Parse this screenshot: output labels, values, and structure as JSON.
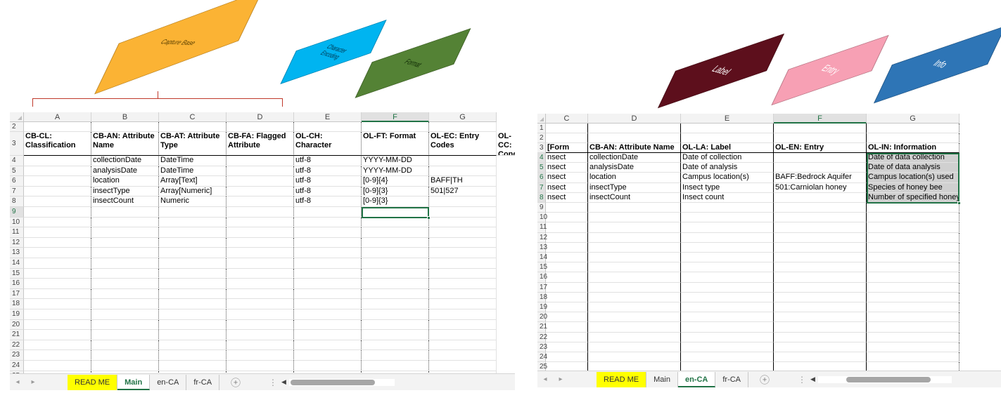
{
  "diagram": {
    "capture_base": {
      "label": "Capture Base",
      "color": "#fbb334"
    },
    "character_encoding": {
      "label": "Character Encoding",
      "color": "#00b4f0"
    },
    "format": {
      "label": "Format",
      "color": "#548235"
    },
    "label": {
      "label": "Label",
      "color": "#5d0f1c"
    },
    "entry": {
      "label": "Entry",
      "color": "#f7a0b4"
    },
    "info": {
      "label": "Info",
      "color": "#2e75b6"
    }
  },
  "left_sheet": {
    "columns": [
      "A",
      "B",
      "C",
      "D",
      "E",
      "F",
      "G"
    ],
    "selected_column": "F",
    "rows": [
      "2",
      "3",
      "4",
      "5",
      "6",
      "7",
      "8",
      "9",
      "10",
      "11",
      "12",
      "13",
      "14",
      "15",
      "16",
      "17",
      "18",
      "19",
      "20",
      "21",
      "22",
      "23",
      "24",
      "25"
    ],
    "headers": [
      "CB-CL: Classification",
      "CB-AN: Attribute Name",
      "CB-AT: Attribute Type",
      "CB-FA: Flagged Attribute",
      "OL-CH: Character",
      "OL-FT: Format",
      "OL-EC: Entry Codes",
      "OL-CC: Cond"
    ],
    "data": [
      [
        "",
        "collectionDate",
        "DateTime",
        "",
        "utf-8",
        "YYYY-MM-DD",
        ""
      ],
      [
        "",
        "analysisDate",
        "DateTime",
        "",
        "utf-8",
        "YYYY-MM-DD",
        ""
      ],
      [
        "",
        "location",
        "Array[Text]",
        "",
        "utf-8",
        "[0-9]{4}",
        "BAFF|TH"
      ],
      [
        "",
        "insectType",
        "Array[Numeric]",
        "",
        "utf-8",
        "[0-9]{3}",
        "501|527"
      ],
      [
        "",
        "insectCount",
        "Numeric",
        "",
        "utf-8",
        "[0-9]{3}",
        ""
      ]
    ],
    "tabs": [
      "READ ME",
      "Main",
      "en-CA",
      "fr-CA"
    ],
    "active_tab": "Main"
  },
  "right_sheet": {
    "columns": [
      "C",
      "D",
      "E",
      "F",
      "G"
    ],
    "selected_column": "F",
    "rows": [
      "1",
      "2",
      "3",
      "4",
      "5",
      "6",
      "7",
      "8",
      "9",
      "10",
      "11",
      "12",
      "13",
      "14",
      "15",
      "16",
      "17",
      "18",
      "19",
      "20",
      "21",
      "22",
      "23",
      "24",
      "25"
    ],
    "headers": [
      "[Form",
      "CB-AN: Attribute Name",
      "OL-LA: Label",
      "OL-EN: Entry",
      "OL-IN: Information"
    ],
    "data": [
      [
        "nsect",
        "collectionDate",
        "Date of collection",
        "",
        "Date of data collection"
      ],
      [
        "nsect",
        "analysisDate",
        "Date of analysis",
        "",
        "Date of data analysis"
      ],
      [
        "nsect",
        "location",
        "Campus location(s)",
        "BAFF:Bedrock Aquifer",
        "Campus location(s) used"
      ],
      [
        "nsect",
        "insectType",
        "Insect type",
        "501:Carniolan honey",
        "Species of honey bee"
      ],
      [
        "nsect",
        "insectCount",
        "Insect count",
        "",
        "Number of specified honey"
      ]
    ],
    "tabs": [
      "READ ME",
      "Main",
      "en-CA",
      "fr-CA"
    ],
    "active_tab": "en-CA"
  },
  "icons": {
    "nav_prev": "◂",
    "nav_next": "▸",
    "add_sheet": "+",
    "more": "⋮",
    "scroll_left": "◀"
  }
}
